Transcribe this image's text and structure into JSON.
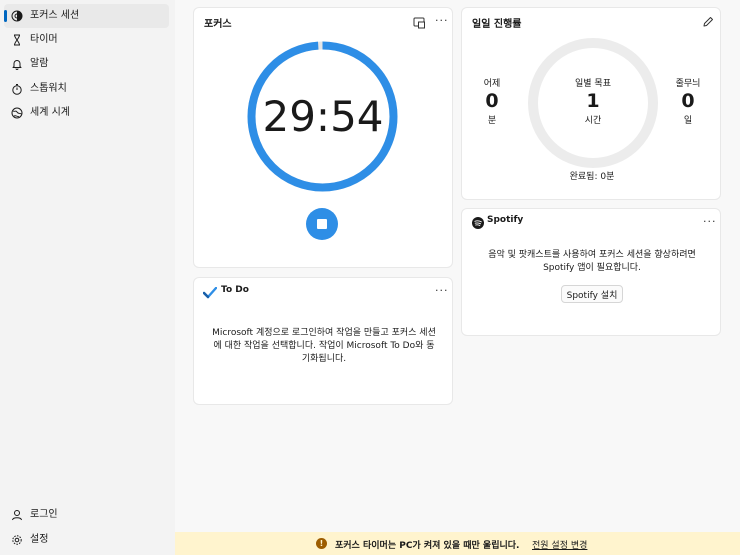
{
  "sidebar": {
    "items": [
      {
        "label": "포커스 세션",
        "icon": "focus-icon",
        "active": true
      },
      {
        "label": "타이머",
        "icon": "hourglass-icon"
      },
      {
        "label": "알람",
        "icon": "bell-icon"
      },
      {
        "label": "스톱워치",
        "icon": "stopwatch-icon"
      },
      {
        "label": "세계 시계",
        "icon": "globe-icon"
      }
    ],
    "bottom": [
      {
        "label": "로그인",
        "icon": "person-icon"
      },
      {
        "label": "설정",
        "icon": "gear-icon"
      }
    ]
  },
  "focus": {
    "title": "포커스",
    "time": "29:54",
    "progress": 0.99
  },
  "daily": {
    "title": "일일 진행률",
    "yesterday": {
      "caption": "어제",
      "value": "0",
      "unit": "분"
    },
    "goal": {
      "caption": "일별 목표",
      "value": "1",
      "unit": "시간"
    },
    "streak": {
      "caption": "줄무늬",
      "value": "0",
      "unit": "일"
    },
    "completed": "완료됨: 0분"
  },
  "spotify": {
    "name": "Spotify",
    "message": "음악 및 팟캐스트를 사용하여 포커스 세션을 향상하려면 Spotify 앱이 필요합니다.",
    "install_label": "Spotify 설치"
  },
  "todo": {
    "title": "To Do",
    "message": "Microsoft 계정으로 로그인하여 작업을 만들고 포커스 세션에 대한 작업을 선택합니다. 작업이 Microsoft To Do와 동기화됩니다."
  },
  "banner": {
    "message": "포커스 타이머는 PC가 켜져 있을 때만 울립니다.",
    "link": "전원 설정 변경"
  },
  "more_label": "···",
  "colors": {
    "accent": "#0067c0",
    "ring": "#2e8ee6",
    "banner": "#fff4ce"
  }
}
